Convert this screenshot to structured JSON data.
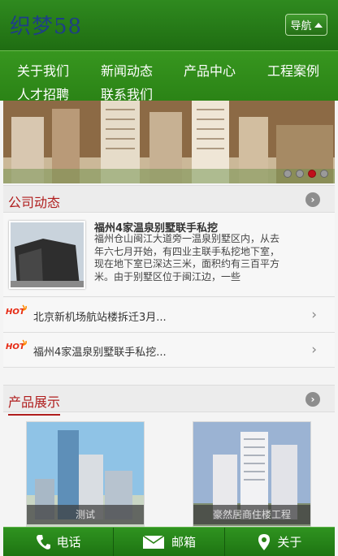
{
  "header": {
    "logo": "织梦58",
    "nav_label": "导航"
  },
  "menu": {
    "items": [
      "关于我们",
      "新闻动态",
      "产品中心",
      "工程案例",
      "人才招聘",
      "联系我们"
    ]
  },
  "banner": {
    "slide_count": 4,
    "active_slide": 2
  },
  "news_section": {
    "title": "公司动态",
    "featured": {
      "title": "福州4家温泉别墅联手私挖",
      "desc": "福州仓山闽江大道旁一温泉别墅区内，从去年六七月开始，有四业主联手私挖地下室，现在地下室已深达三米，面积约有三百平方米。由于别墅区位于闽江边，一些"
    },
    "items": [
      {
        "badge": "HOT",
        "text": "北京新机场航站楼拆迁3月..."
      },
      {
        "badge": "HOT",
        "text": "福州4家温泉别墅联手私挖..."
      }
    ]
  },
  "product_section": {
    "title": "产品展示",
    "items": [
      {
        "caption": "测试"
      },
      {
        "caption": "豪然居商住楼工程"
      }
    ]
  },
  "bottom_bar": {
    "phone": "电话",
    "mail": "邮箱",
    "about": "关于"
  },
  "colors": {
    "brand_green": "#2b8316",
    "accent_red": "#b01e1e",
    "logo_blue": "#1e3f86"
  }
}
